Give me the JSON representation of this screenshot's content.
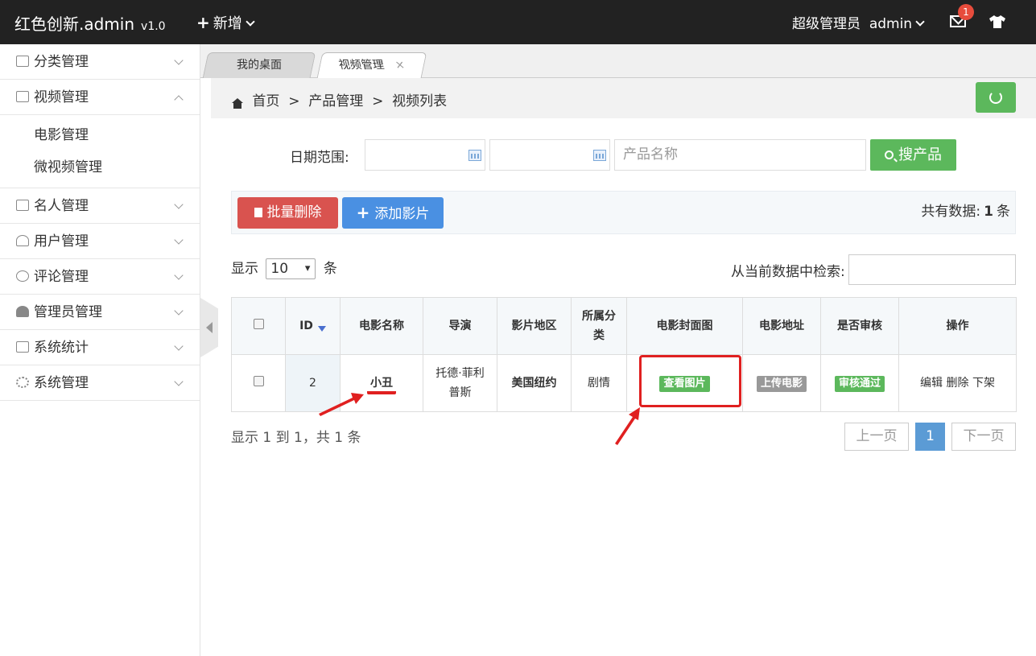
{
  "app": {
    "title": "红色创新.admin",
    "version": "v1.0",
    "new_label": "新增"
  },
  "user": {
    "role": "超级管理员",
    "name": "admin",
    "mail_badge": "1"
  },
  "sidebar": {
    "items": [
      {
        "label": "分类管理",
        "icon": "bag-icon"
      },
      {
        "label": "视频管理",
        "icon": "book-icon",
        "expanded": true,
        "children": [
          "电影管理",
          "微视频管理"
        ]
      },
      {
        "label": "名人管理",
        "icon": "book-icon"
      },
      {
        "label": "用户管理",
        "icon": "user-icon"
      },
      {
        "label": "评论管理",
        "icon": "comment-icon"
      },
      {
        "label": "管理员管理",
        "icon": "user-solid-icon"
      },
      {
        "label": "系统统计",
        "icon": "chart-icon"
      },
      {
        "label": "系统管理",
        "icon": "gear-icon"
      }
    ]
  },
  "tabs": [
    {
      "label": "我的桌面"
    },
    {
      "label": "视频管理",
      "active": true,
      "close": "×"
    }
  ],
  "breadcrumb": {
    "home": "首页",
    "sep": ">",
    "level1": "产品管理",
    "level2": "视频列表"
  },
  "search": {
    "date_label": "日期范围:",
    "name_placeholder": "产品名称",
    "button": "搜产品"
  },
  "actions": {
    "batch_delete": "批量删除",
    "add_film": "添加影片",
    "total_prefix": "共有数据:",
    "total_count": "1",
    "total_suffix": "条"
  },
  "length_menu": {
    "prefix": "显示",
    "value": "10",
    "suffix": "条"
  },
  "filter": {
    "label": "从当前数据中检索:"
  },
  "table": {
    "headers": [
      "ID",
      "电影名称",
      "导演",
      "影片地区",
      "所属分\n类",
      "电影封面图",
      "电影地址",
      "是否审核",
      "操作"
    ],
    "rows": [
      {
        "id": "2",
        "name": "小丑",
        "director_line1": "托德·菲利",
        "director_line2": "普斯",
        "region": "美国纽约",
        "category": "剧情",
        "cover_btn": "查看图片",
        "address_btn": "上传电影",
        "review_btn": "审核通过",
        "op_edit": "编辑",
        "op_delete": "删除",
        "op_offline": "下架"
      }
    ]
  },
  "footer": {
    "info": "显示 1 到 1，共 1 条",
    "prev": "上一页",
    "page": "1",
    "next": "下一页"
  },
  "colors": {
    "green": "#5cb85c",
    "red": "#d9534f",
    "blue": "#4a90e2",
    "annotation_red": "#e02020"
  }
}
